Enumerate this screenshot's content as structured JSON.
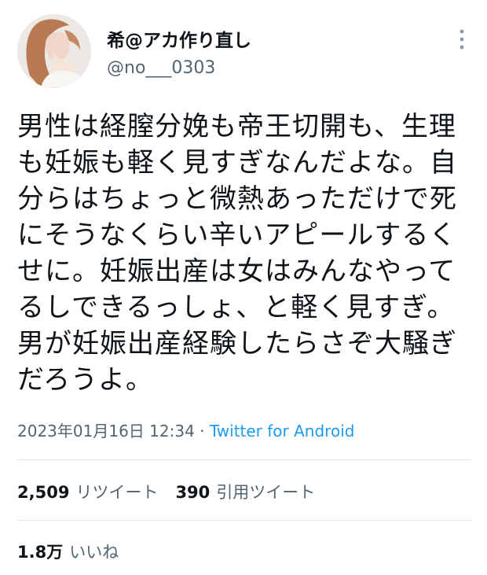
{
  "user": {
    "display_name": "希@アカ作り直し",
    "handle": "@no___0303"
  },
  "tweet": {
    "text": "男性は経膣分娩も帝王切開も、生理も妊娠も軽く見すぎなんだよな。自分らはちょっと微熱あっただけで死にそうなくらい辛いアピールするくせに。妊娠出産は女はみんなやってるしできるっしょ、と軽く見すぎ。男が妊娠出産経験したらさぞ大騒ぎだろうよ。",
    "timestamp": "2023年01月16日 12:34",
    "separator": " · ",
    "source": "Twitter for Android"
  },
  "stats": {
    "retweets_count": "2,509",
    "retweets_label": "リツイート",
    "quotes_count": "390",
    "quotes_label": "引用ツイート",
    "likes_count": "1.8万",
    "likes_label": "いいね"
  },
  "icons": {
    "more": "more-vertical-icon"
  },
  "colors": {
    "text_primary": "#0f1419",
    "text_secondary": "#536471",
    "link": "#1d9bf0",
    "divider": "#e3e6e9"
  }
}
